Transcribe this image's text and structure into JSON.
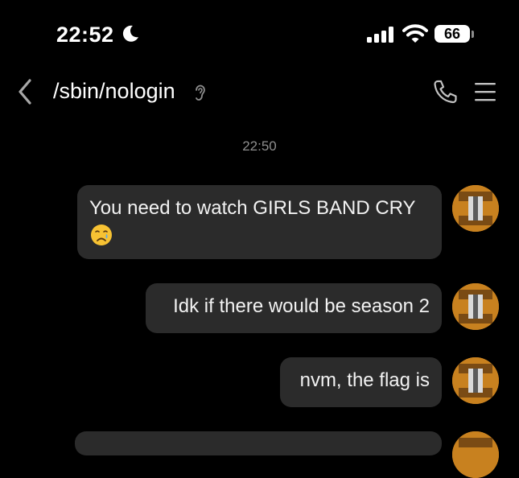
{
  "status_bar": {
    "time": "22:52",
    "battery": "66",
    "icons": [
      "moon-icon",
      "cellular-signal-icon",
      "wifi-icon",
      "battery-icon"
    ]
  },
  "header": {
    "title": "/sbin/nologin",
    "icons": [
      "back-chevron-icon",
      "ear-icon",
      "phone-icon",
      "menu-icon"
    ]
  },
  "conversation": {
    "timestamp": "22:50",
    "messages": [
      {
        "text": "You need to watch GIRLS BAND CRY",
        "emoji": "crying-face-emoji"
      },
      {
        "text": "Idk if there would be season 2"
      },
      {
        "text": "nvm, the flag is"
      },
      {
        "text": ""
      }
    ]
  },
  "colors": {
    "background": "#000000",
    "bubble": "#2b2b2b",
    "timestamp": "#8e8e8e",
    "avatar": "#c8811f"
  }
}
